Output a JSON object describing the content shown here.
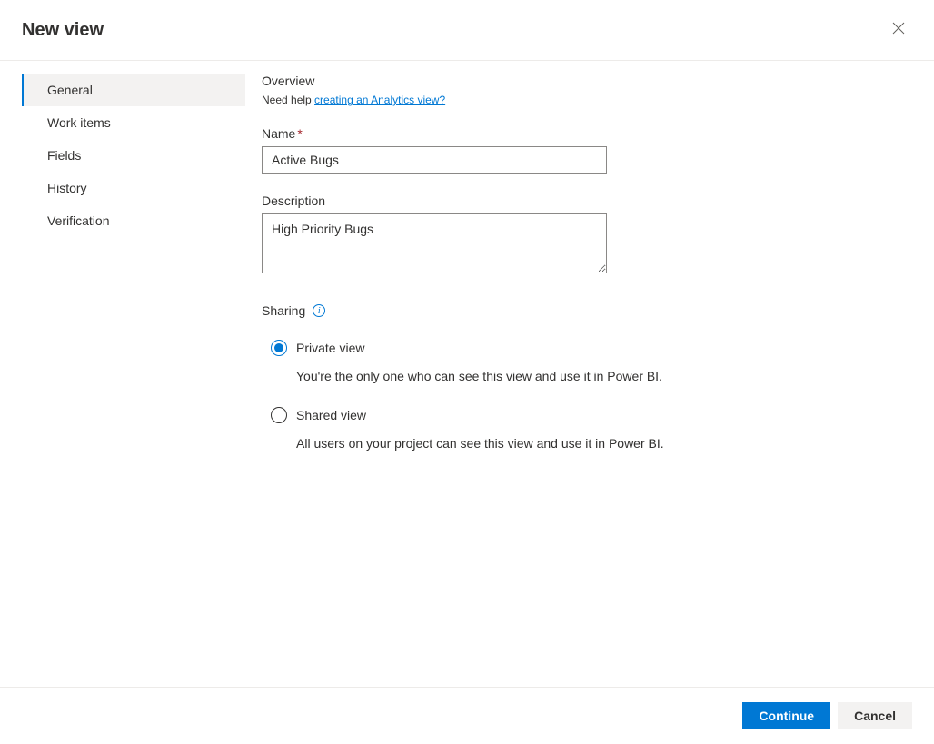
{
  "header": {
    "title": "New view"
  },
  "sidebar": {
    "items": [
      {
        "label": "General",
        "active": true
      },
      {
        "label": "Work items",
        "active": false
      },
      {
        "label": "Fields",
        "active": false
      },
      {
        "label": "History",
        "active": false
      },
      {
        "label": "Verification",
        "active": false
      }
    ]
  },
  "content": {
    "overview_title": "Overview",
    "help_prefix": "Need help ",
    "help_link": "creating an Analytics view?",
    "name_label": "Name",
    "name_value": "Active Bugs",
    "description_label": "Description",
    "description_value": "High Priority Bugs",
    "sharing_label": "Sharing",
    "private": {
      "label": "Private view",
      "description": "You're the only one who can see this view and use it in Power BI."
    },
    "shared": {
      "label": "Shared view",
      "description": "All users on your project can see this view and use it in Power BI."
    }
  },
  "footer": {
    "continue": "Continue",
    "cancel": "Cancel"
  }
}
